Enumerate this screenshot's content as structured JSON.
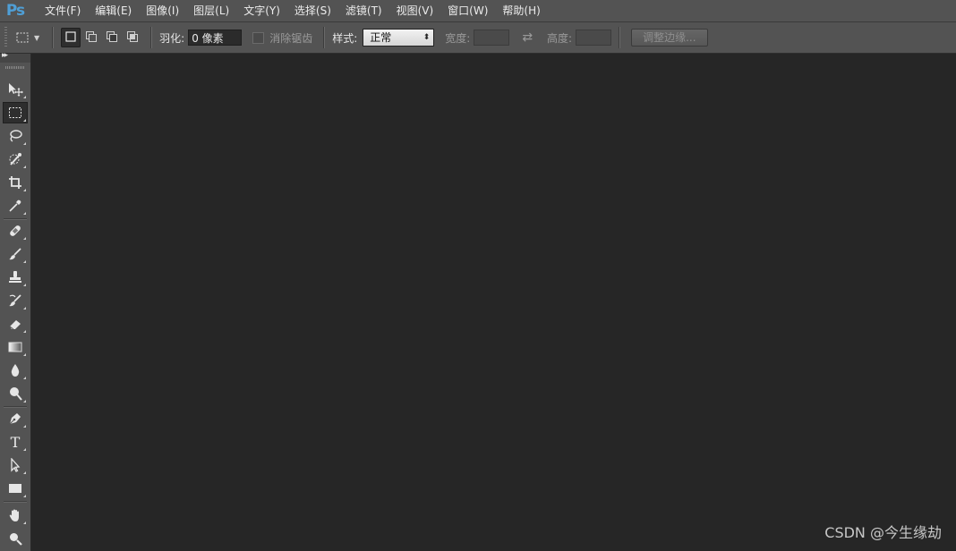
{
  "app": {
    "logo_text": "Ps",
    "logo_color": "#4f9fd6"
  },
  "menu": [
    {
      "label": "文件(F)"
    },
    {
      "label": "编辑(E)"
    },
    {
      "label": "图像(I)"
    },
    {
      "label": "图层(L)"
    },
    {
      "label": "文字(Y)"
    },
    {
      "label": "选择(S)"
    },
    {
      "label": "滤镜(T)"
    },
    {
      "label": "视图(V)"
    },
    {
      "label": "窗口(W)"
    },
    {
      "label": "帮助(H)"
    }
  ],
  "options": {
    "tool_preset_icon": "rectangular-marquee-icon",
    "selection_modes": [
      "new-selection-icon",
      "add-to-selection-icon",
      "subtract-from-selection-icon",
      "intersect-selection-icon"
    ],
    "feather_label": "羽化:",
    "feather_value": "0 像素",
    "antialias_label": "消除锯齿",
    "style_label": "样式:",
    "style_value": "正常",
    "width_label": "宽度:",
    "height_label": "高度:",
    "swap_icon": "swap-arrows-icon",
    "refine_edge_label": "调整边缘..."
  },
  "tools": [
    {
      "name": "move-tool",
      "icon": "move-icon"
    },
    {
      "name": "rectangular-marquee-tool",
      "icon": "marquee-icon",
      "active": true
    },
    {
      "name": "lasso-tool",
      "icon": "lasso-icon"
    },
    {
      "name": "quick-selection-tool",
      "icon": "quick-selection-icon"
    },
    {
      "name": "crop-tool",
      "icon": "crop-icon"
    },
    {
      "name": "eyedropper-tool",
      "icon": "eyedropper-icon"
    },
    {
      "name": "healing-brush-tool",
      "icon": "bandage-icon"
    },
    {
      "name": "brush-tool",
      "icon": "brush-icon"
    },
    {
      "name": "clone-stamp-tool",
      "icon": "stamp-icon"
    },
    {
      "name": "history-brush-tool",
      "icon": "history-brush-icon"
    },
    {
      "name": "eraser-tool",
      "icon": "eraser-icon"
    },
    {
      "name": "gradient-tool",
      "icon": "gradient-icon"
    },
    {
      "name": "blur-tool",
      "icon": "drop-icon"
    },
    {
      "name": "dodge-tool",
      "icon": "dodge-icon"
    },
    {
      "name": "pen-tool",
      "icon": "pen-icon"
    },
    {
      "name": "type-tool",
      "icon": "type-icon",
      "glyph": "T"
    },
    {
      "name": "path-selection-tool",
      "icon": "path-selection-icon"
    },
    {
      "name": "rectangle-tool",
      "icon": "rectangle-shape-icon"
    },
    {
      "name": "hand-tool",
      "icon": "hand-icon"
    },
    {
      "name": "zoom-tool",
      "icon": "zoom-icon"
    }
  ],
  "watermark": "CSDN @今生缘劫",
  "colors": {
    "chrome": "#535353",
    "workspace": "#262626"
  }
}
